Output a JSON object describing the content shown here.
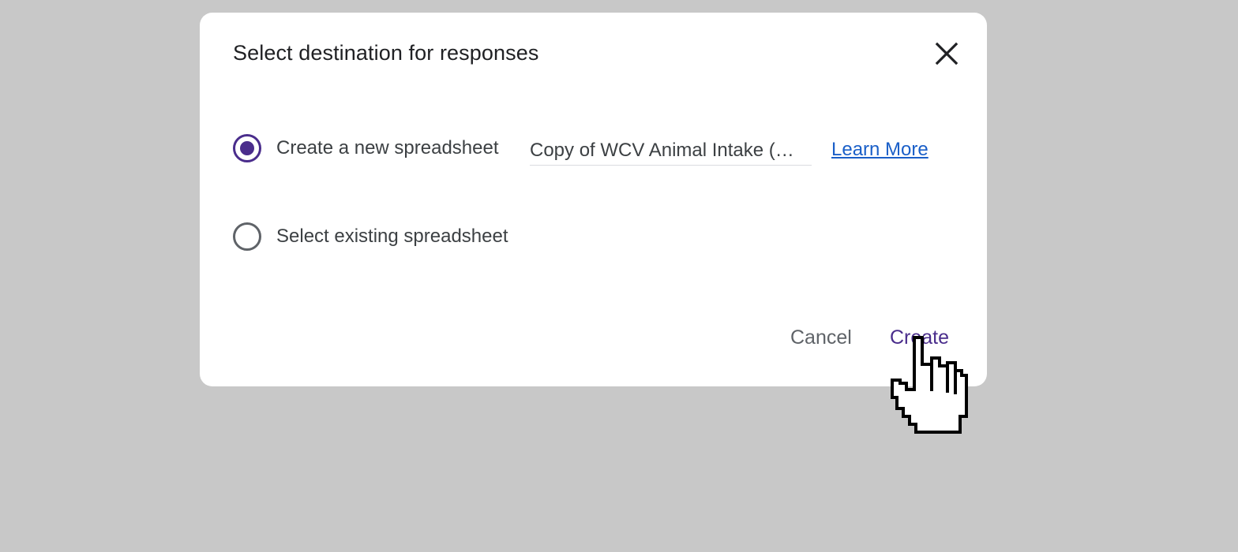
{
  "dialog": {
    "title": "Select destination for responses",
    "close_icon": "close-icon",
    "options": [
      {
        "label": "Create a new spreadsheet",
        "checked": true
      },
      {
        "label": "Select existing spreadsheet",
        "checked": false
      }
    ],
    "spreadsheet_name": "Copy of WCV Animal Intake (…",
    "learn_more_label": "Learn More",
    "cancel_label": "Cancel",
    "create_label": "Create"
  },
  "colors": {
    "accent": "#4a2d8c",
    "link": "#1a5fc8",
    "backdrop": "#c8c8c8"
  },
  "cursor_icon": "hand-pointer-icon"
}
